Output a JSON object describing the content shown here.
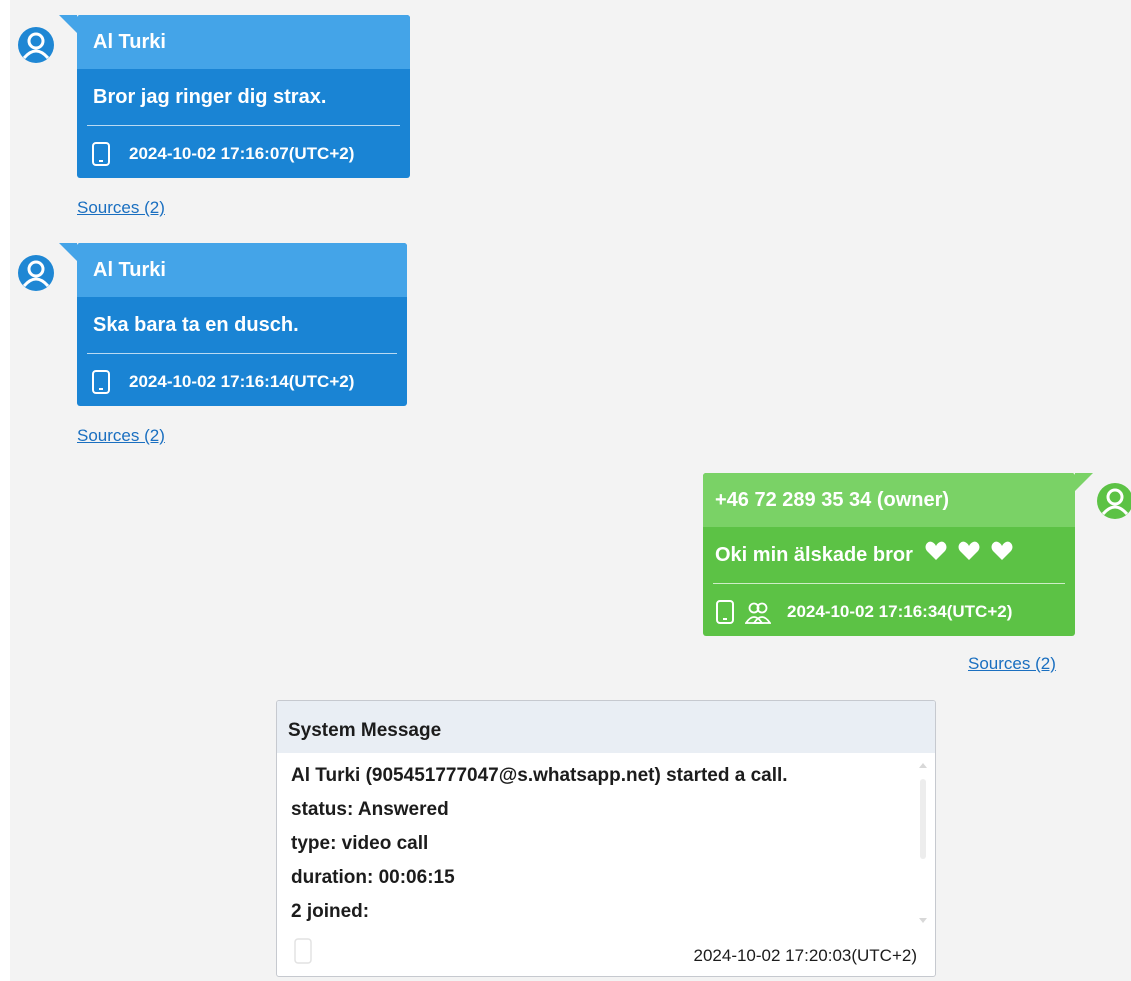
{
  "messages": [
    {
      "sender": "Al Turki",
      "text": "Bror jag ringer dig strax.",
      "timestamp": "2024-10-02 17:16:07(UTC+2)",
      "sources": "Sources (2)",
      "side": "left",
      "icons": [
        "phone-icon"
      ]
    },
    {
      "sender": "Al Turki",
      "text": "Ska bara ta en dusch.",
      "timestamp": "2024-10-02 17:16:14(UTC+2)",
      "sources": "Sources (2)",
      "side": "left",
      "icons": [
        "phone-icon"
      ]
    },
    {
      "sender": "+46 72 289 35 34 (owner)",
      "text": "Oki min älskade bror",
      "timestamp": "2024-10-02 17:16:34(UTC+2)",
      "sources": "Sources (2)",
      "side": "right",
      "hearts": 3,
      "icons": [
        "phone-icon",
        "group-icon"
      ]
    }
  ],
  "system_message": {
    "title": "System Message",
    "lines": [
      "Al Turki (905451777047@s.whatsapp.net) started a call.",
      "status: Answered",
      "type: video call",
      "duration: 00:06:15",
      "2 joined:"
    ],
    "timestamp": "2024-10-02 17:20:03(UTC+2)"
  },
  "colors": {
    "incoming_bubble": "#1a84d4",
    "incoming_header": "#44a4e8",
    "outgoing_bubble": "#5cc245",
    "outgoing_header": "#7ad266",
    "link": "#1a6fc0",
    "background": "#f3f3f3"
  }
}
